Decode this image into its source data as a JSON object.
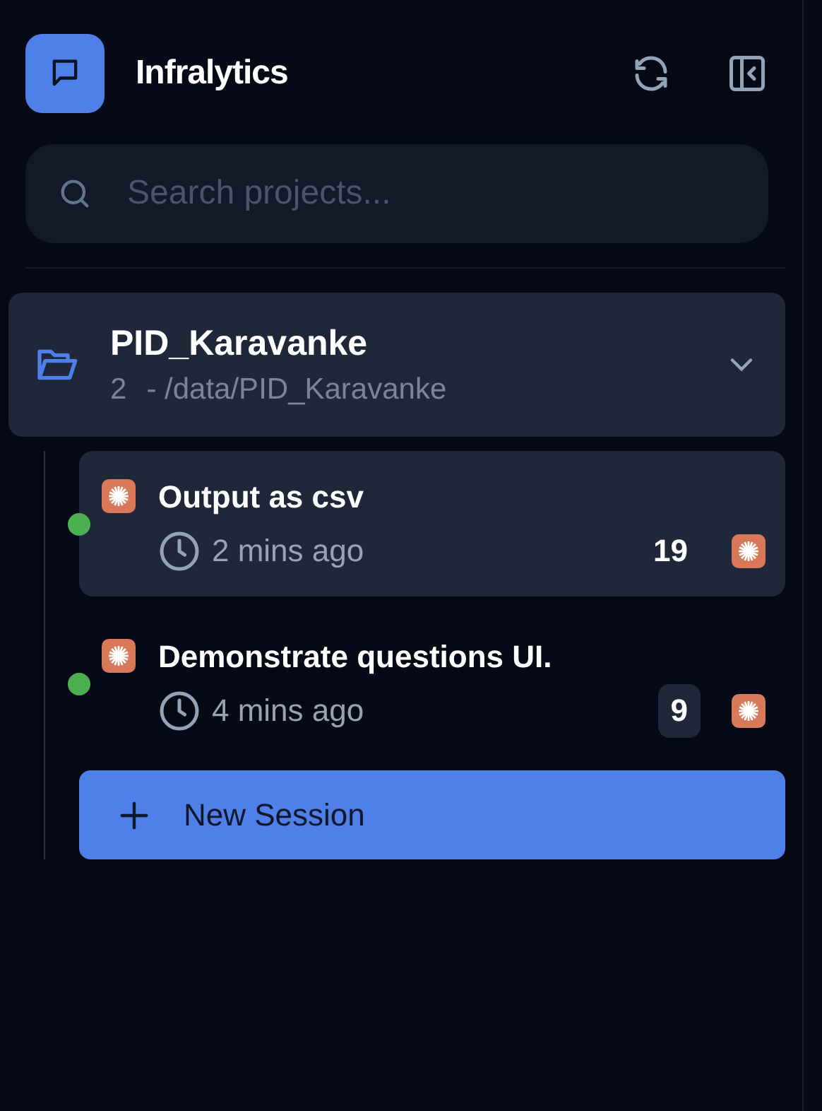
{
  "app": {
    "title": "Infralytics"
  },
  "search": {
    "placeholder": "Search projects..."
  },
  "project": {
    "name": "PID_Karavanke",
    "count": "2",
    "path": "- /data/PID_Karavanke",
    "expanded": true,
    "sessions": [
      {
        "title": "Output as csv",
        "time": "2 mins ago",
        "count": "19",
        "selected": true,
        "color": "#4caf50"
      },
      {
        "title": "Demonstrate questions UI.",
        "time": "4 mins ago",
        "count": "9",
        "selected": false,
        "color": "#4caf50"
      }
    ]
  },
  "new_session": {
    "label": "New Session"
  }
}
